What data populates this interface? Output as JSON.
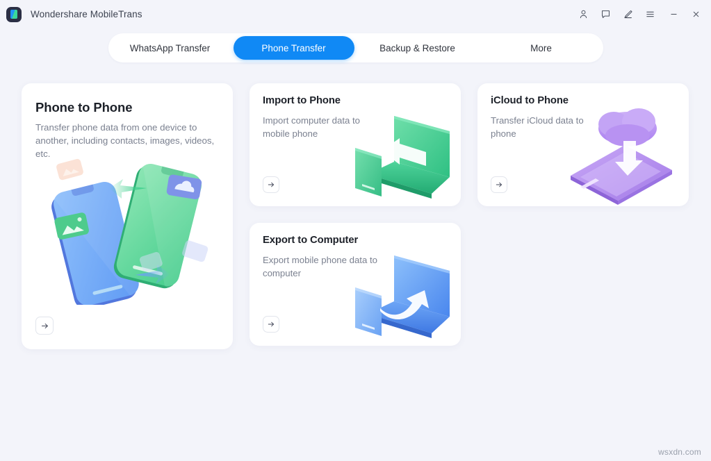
{
  "window": {
    "title": "Wondershare MobileTrans",
    "logo_icon": "app-logo-icon",
    "controls": [
      {
        "name": "account-icon",
        "label": "Account"
      },
      {
        "name": "feedback-icon",
        "label": "Feedback"
      },
      {
        "name": "edit-icon",
        "label": "Edit"
      },
      {
        "name": "menu-icon",
        "label": "Menu"
      },
      {
        "name": "minimize-icon",
        "label": "Minimize"
      },
      {
        "name": "close-icon",
        "label": "Close"
      }
    ]
  },
  "tabs": [
    {
      "label": "WhatsApp Transfer",
      "active": false
    },
    {
      "label": "Phone Transfer",
      "active": true
    },
    {
      "label": "Backup & Restore",
      "active": false
    },
    {
      "label": "More",
      "active": false
    }
  ],
  "cards": {
    "phone_to_phone": {
      "title": "Phone to Phone",
      "subtitle": "Transfer phone data from one device to another, including contacts, images, videos, etc.",
      "action_icon": "arrow-right-icon",
      "illustration": "two-phones-transfer-illustration"
    },
    "import_to_phone": {
      "title": "Import to Phone",
      "subtitle": "Import computer data to mobile phone",
      "action_icon": "arrow-right-icon",
      "illustration": "laptop-to-phone-green-illustration"
    },
    "icloud_to_phone": {
      "title": "iCloud to Phone",
      "subtitle": "Transfer iCloud data to phone",
      "action_icon": "arrow-right-icon",
      "illustration": "cloud-to-phone-purple-illustration"
    },
    "export_to_computer": {
      "title": "Export to Computer",
      "subtitle": "Export mobile phone data to computer",
      "action_icon": "arrow-right-icon",
      "illustration": "phone-to-laptop-blue-illustration"
    }
  },
  "watermark": "wsxdn.com",
  "colors": {
    "background": "#f3f4fa",
    "accent_blue": "#1089f5",
    "card_white": "#ffffff",
    "title_text": "#1d2129",
    "subtitle_text": "#7b8190",
    "green_illustration": "#3ecf8e",
    "purple_illustration": "#b18cf0",
    "blue_illustration": "#5b9cf8"
  }
}
